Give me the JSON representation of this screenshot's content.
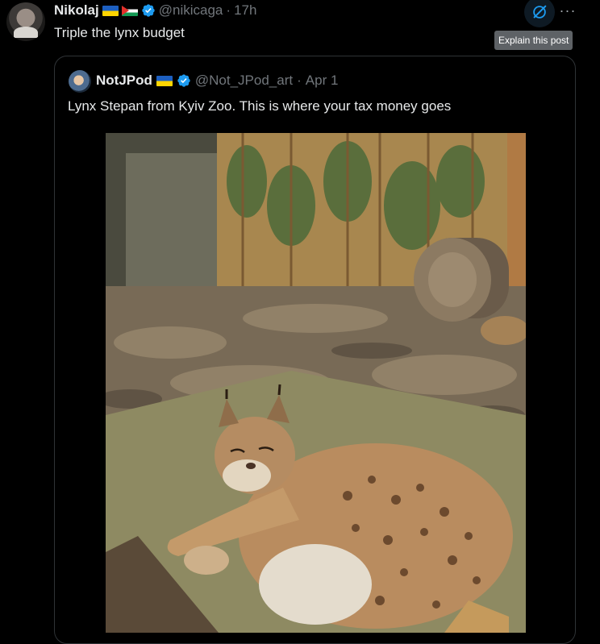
{
  "tweet": {
    "author_name": "Nikolaj",
    "handle": "@nikicaga",
    "separator": "·",
    "time": "17h",
    "text": "Triple the lynx budget"
  },
  "actions": {
    "grok_icon": "grok-slash-icon",
    "more_label": "···",
    "tooltip": "Explain this post"
  },
  "quote": {
    "author_name": "NotJPod",
    "handle": "@Not_JPod_art",
    "separator": "·",
    "date": "Apr 1",
    "text": "Lynx Stepan from Kyiv Zoo. This is where your tax money goes"
  },
  "colors": {
    "verified": "#1d9bf0",
    "muted": "#71767b",
    "tooltip_bg": "#5e6266"
  }
}
